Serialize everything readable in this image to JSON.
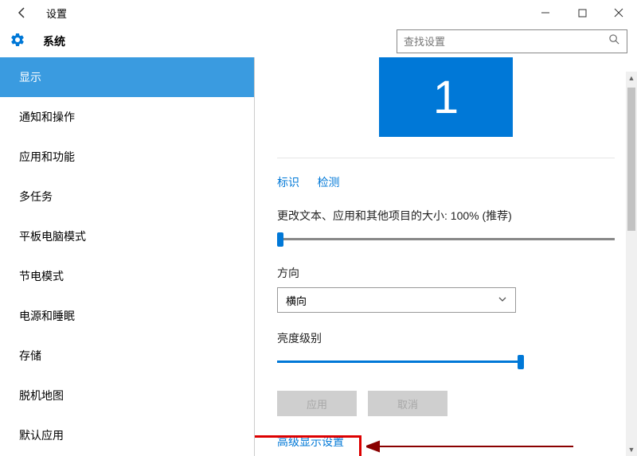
{
  "titlebar": {
    "title": "设置"
  },
  "header": {
    "section": "系统"
  },
  "search": {
    "placeholder": "查找设置"
  },
  "sidebar": {
    "items": [
      {
        "label": "显示",
        "active": true
      },
      {
        "label": "通知和操作"
      },
      {
        "label": "应用和功能"
      },
      {
        "label": "多任务"
      },
      {
        "label": "平板电脑模式"
      },
      {
        "label": "节电模式"
      },
      {
        "label": "电源和睡眠"
      },
      {
        "label": "存储"
      },
      {
        "label": "脱机地图"
      },
      {
        "label": "默认应用"
      }
    ]
  },
  "content": {
    "monitor_number": "1",
    "link_identify": "标识",
    "link_detect": "检测",
    "scale_label": "更改文本、应用和其他项目的大小: 100% (推荐)",
    "orientation_label": "方向",
    "orientation_value": "横向",
    "brightness_label": "亮度级别",
    "btn_apply": "应用",
    "btn_cancel": "取消",
    "advanced_link": "高级显示设置"
  }
}
